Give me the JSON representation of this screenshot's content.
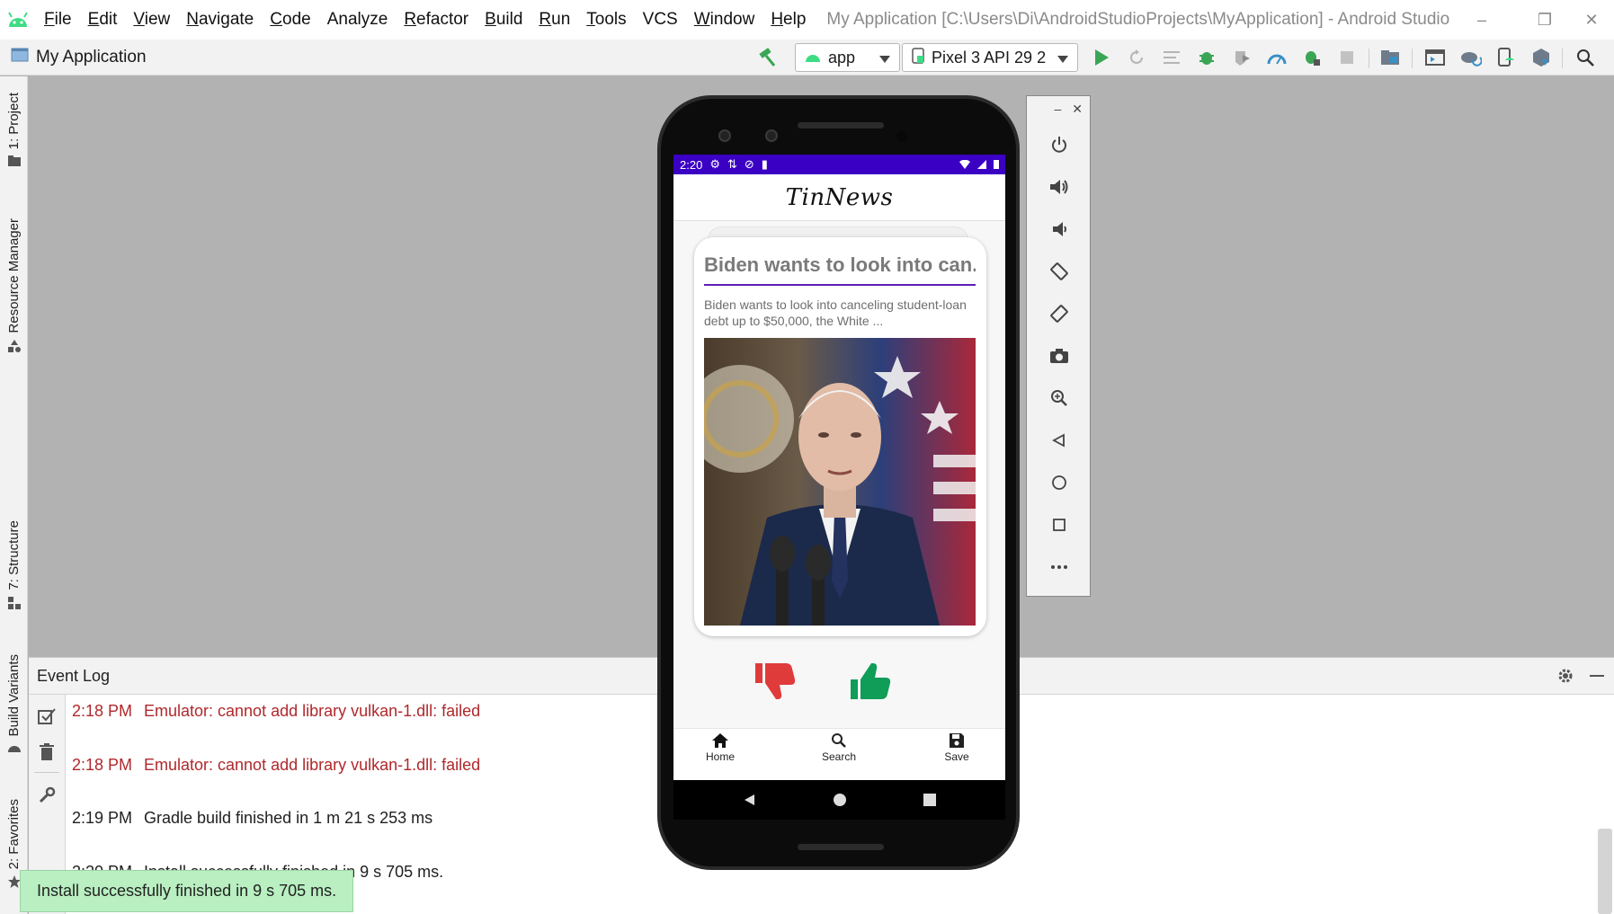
{
  "window": {
    "title": "My Application [C:\\Users\\Di\\AndroidStudioProjects\\MyApplication] - Android Studio",
    "menu": [
      {
        "label": "File",
        "u": "F",
        "rest": "ile"
      },
      {
        "label": "Edit",
        "u": "E",
        "rest": "dit"
      },
      {
        "label": "View",
        "u": "V",
        "rest": "iew"
      },
      {
        "label": "Navigate",
        "u": "N",
        "rest": "avigate"
      },
      {
        "label": "Code",
        "u": "C",
        "rest": "ode"
      },
      {
        "label": "Analyze",
        "u": "",
        "rest": "Analyze"
      },
      {
        "label": "Refactor",
        "u": "R",
        "rest": "efactor"
      },
      {
        "label": "Build",
        "u": "B",
        "rest": "uild"
      },
      {
        "label": "Run",
        "u": "R",
        "rest": "un"
      },
      {
        "label": "Tools",
        "u": "T",
        "rest": "ools"
      },
      {
        "label": "VCS",
        "u": "",
        "rest": "VCS"
      },
      {
        "label": "Window",
        "u": "W",
        "rest": "indow"
      },
      {
        "label": "Help",
        "u": "H",
        "rest": "elp"
      }
    ]
  },
  "toolbar": {
    "project_name": "My Application",
    "run_config": "app",
    "device": "Pixel 3 API 29 2",
    "accent_green": "#3aa655"
  },
  "left_strip": {
    "project": "1: Project",
    "resource_manager": "Resource Manager",
    "structure": "7: Structure",
    "build_variants": "Build Variants",
    "favorites": "2: Favorites"
  },
  "event_log": {
    "title": "Event Log",
    "entries": [
      {
        "time": "2:18 PM",
        "message": "Emulator: cannot add library vulkan-1.dll: failed",
        "level": "error"
      },
      {
        "time": "2:18 PM",
        "message": "Emulator: cannot add library vulkan-1.dll: failed",
        "level": "error"
      },
      {
        "time": "2:19 PM",
        "message": "Gradle build finished in 1 m 21 s 253 ms",
        "level": "info"
      },
      {
        "time": "2:20 PM",
        "message": "Install successfully finished in 9 s 705 ms.",
        "level": "info"
      }
    ],
    "error_color": "#b0282c"
  },
  "toast": {
    "message": "Install successfully finished in 9 s 705 ms."
  },
  "emulator": {
    "status_time": "2:20",
    "status_bar_color": "#3a00c4",
    "app_title": "TinNews",
    "card": {
      "title": "Biden wants to look into can...",
      "description": "Biden wants to look into canceling student-loan debt up to $50,000, the White ..."
    },
    "dislike_color": "#e03b3b",
    "like_color": "#0f9d58",
    "nav": {
      "home": "Home",
      "search": "Search",
      "save": "Save"
    }
  }
}
